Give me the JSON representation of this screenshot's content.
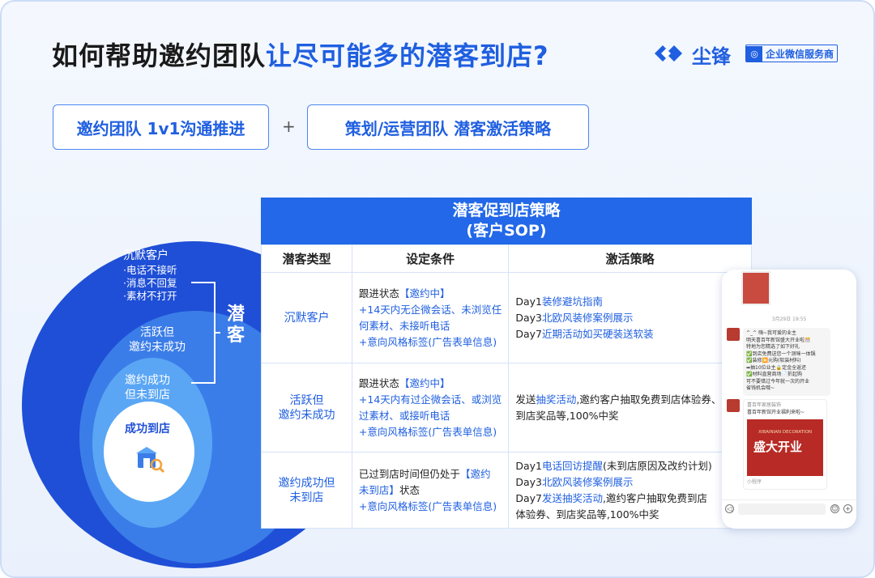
{
  "title": {
    "part1": "如何帮助邀约团队",
    "part2": "让尽可能多的潜客到店?"
  },
  "logo": {
    "name": "尘锋",
    "badge": "企业微信服务商"
  },
  "pills": {
    "left": "邀约团队 1v1沟通推进",
    "plus": "+",
    "right": "策划/运营团队 潜客激活策略"
  },
  "circles": {
    "silent_title": "沉默客户",
    "silent_items": [
      "·电话不接听",
      "·消息不回复",
      "·素材不打开"
    ],
    "active": [
      "活跃但",
      "邀约未成功"
    ],
    "invited": [
      "邀约成功",
      "但未到店"
    ],
    "success": "成功到店",
    "group_label": "潜客"
  },
  "table": {
    "title_line1": "潜客促到店策略",
    "title_line2": "(客户SOP)",
    "headers": [
      "潜客类型",
      "设定条件",
      "激活策略"
    ],
    "rows": [
      {
        "type": "沉默客户",
        "cond_prefix": "跟进状态",
        "cond_tag": "【邀约中】",
        "cond_lines": [
          "+14天内无企微会话、未浏览任",
          "何素材、未接听电话",
          "+意向风格标签(广告表单信息)"
        ],
        "acts": [
          {
            "day": "Day1",
            "text": "装修避坑指南"
          },
          {
            "day": "Day3",
            "text": "北欧风装修案例展示"
          },
          {
            "day": "Day7",
            "text": "近期活动如买硬装送软装"
          }
        ]
      },
      {
        "type_lines": [
          "活跃但",
          "邀约未成功"
        ],
        "cond_prefix": "跟进状态",
        "cond_tag": "【邀约中】",
        "cond_lines": [
          "+14天内有过企微会话、或浏览",
          "过素材、或接听电话",
          "+意向风格标签(广告表单信息)"
        ],
        "act_prefix": "发送",
        "act_hl": "抽奖活动",
        "act_rest1": ",邀约客户抽取免费到店体验券、",
        "act_rest2": "到店奖品等,100%中奖"
      },
      {
        "type_lines": [
          "邀约成功但",
          "未到店"
        ],
        "cond_line1": "已过到店时间但仍处于",
        "cond_tag1": "【邀约",
        "cond_tag2": "未到店】",
        "cond_line2_rest": "状态",
        "cond_line3": "+意向风格标签(广告表单信息)",
        "act1_day": "Day1",
        "act1_hl": "电话回访提醒",
        "act1_rest": "(未到店原因及改约计划)",
        "act2_day": "Day3",
        "act2_hl": "北欧风装修案例展示",
        "act3_day": "Day7",
        "act3_hl": "发送抽奖活动",
        "act3_rest": ",邀约客户抽取免费到店",
        "act3_line2": "体验券、到店奖品等,100%中奖"
      }
    ]
  },
  "phone": {
    "date": "3月29日 19:55",
    "msg_lines": [
      "^_^ 嗨~我可爱的业主",
      "明天喜百年新馆盛大开业啦🎊",
      "特地为您精选了如下好礼",
      "✅到店免费送您一个测咪一体锅",
      "✅装修🈚元购(软装材料)",
      "➡抽10位业主🔒定金全返还",
      "✅材料直营商场📄折起购",
      "可不要错过今年就一次的开业",
      "省钱机会哦~"
    ],
    "card_sender": "喜百年家居装饰",
    "card_title": "喜百年新馆开业福利来啦~",
    "poster_small": "XIBAINIAN DECORATION",
    "poster_big": "盛大开业",
    "card_footer": "小程序"
  }
}
